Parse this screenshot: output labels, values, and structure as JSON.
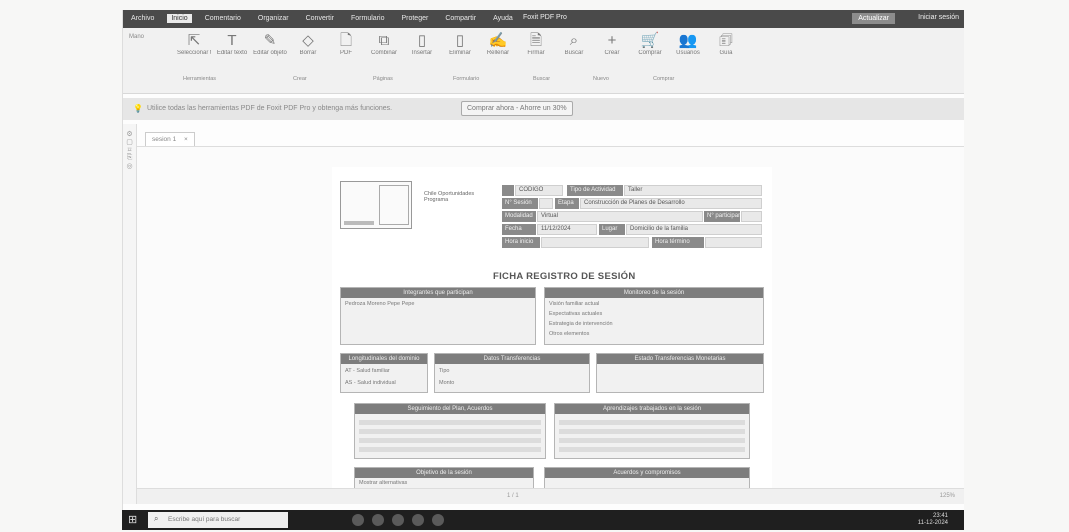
{
  "window": {
    "title": "Foxit PDF Pro",
    "upgrade_label": "Actualizar",
    "login_label": "Iniciar sesión",
    "tabs": [
      "Archivo",
      "Inicio",
      "Comentario",
      "Organizar",
      "Convertir",
      "Formulario",
      "Proteger",
      "Compartir",
      "Ayuda"
    ]
  },
  "ribbon": {
    "mano": "Mano",
    "groups": [
      {
        "icon": "text-select-icon",
        "glyph": "⇱",
        "label": "Seleccionar texto"
      },
      {
        "icon": "text-icon",
        "glyph": "T",
        "label": "Editar texto"
      },
      {
        "icon": "pencil-icon",
        "glyph": "✎",
        "label": "Editar objeto"
      },
      {
        "icon": "eraser-icon",
        "glyph": "◇",
        "label": "Borrar"
      },
      {
        "icon": "file-icon",
        "glyph": "🗋",
        "label": "PDF"
      },
      {
        "icon": "copy-icon",
        "glyph": "⧉",
        "label": "Combinar"
      },
      {
        "icon": "page-icon",
        "glyph": "▯",
        "label": "Insertar"
      },
      {
        "icon": "pages-icon",
        "glyph": "▯",
        "label": "Eliminar"
      },
      {
        "icon": "sign-icon",
        "glyph": "✍",
        "label": "Rellenar"
      },
      {
        "icon": "doc-icon",
        "glyph": "🗎",
        "label": "Firmar"
      },
      {
        "icon": "search-icon",
        "glyph": "⌕",
        "label": "Buscar"
      },
      {
        "icon": "plus-icon",
        "glyph": "+",
        "label": "Crear"
      },
      {
        "icon": "cart-icon",
        "glyph": "🛒",
        "label": "Comprar"
      },
      {
        "icon": "people-icon",
        "glyph": "👥",
        "label": "Usuarios"
      },
      {
        "icon": "info-icon",
        "glyph": "🗊",
        "label": "Guía"
      }
    ],
    "group_labels": [
      "Herramientas",
      "Crear",
      "Páginas",
      "Formulario",
      "Buscar",
      "Nuevo",
      "Comprar"
    ]
  },
  "notice": {
    "text": "Utilice todas las herramientas PDF de Foxit PDF Pro y obtenga más funciones.",
    "button": "Comprar ahora - Ahorre un 30%"
  },
  "document": {
    "tab_label": "sesion 1",
    "header": {
      "codigo_value": "CÓDIGO",
      "tipo_label": "Tipo de Actividad",
      "tipo_value": "Taller",
      "sesion_label": "N° Sesión",
      "etapa_label": "Etapa",
      "etapa_value": "Construcción de Planes de Desarrollo",
      "modalidad_label": "Modalidad",
      "modalidad_value": "Virtual",
      "participantes_label": "N° participantes",
      "fecha_label": "Fecha",
      "fecha_value": "11/12/2024",
      "lugar_label": "Lugar",
      "lugar_value": "Domicilio de la familia",
      "hora_inicio_label": "Hora inicio",
      "hora_termino_label": "Hora término"
    },
    "logo_text": "Chile Oportunidades Programa",
    "form_title": "FICHA REGISTRO DE SESIÓN",
    "integrantes_title": "Integrantes que participan",
    "integrantes_value": "Pedroza Moreno Pepe Pepe",
    "monitoreo_title": "Monitoreo de la sesión",
    "monitoreo_items": [
      "Visión familiar actual",
      "Expectativas actuales",
      "Estrategia de intervención",
      "Otros elementos"
    ],
    "longitudinales_title": "Longitudinales del dominio",
    "longitudinales_items": [
      "AT - Salud familiar",
      "AS - Salud individual"
    ],
    "datos_title": "Datos Transferencias",
    "datos_labels": [
      "Tipo",
      "Monto"
    ],
    "estado_title": "Estado Transferencias Monetarias",
    "tabla1_title": "Seguimiento del Plan, Acuerdos",
    "tabla2_title": "Aprendizajes trabajados en la sesión",
    "objetivo_title": "Objetivo de la sesión",
    "objetivo_value": "Mostrar alternativas",
    "acuerdos_title": "Acuerdos y compromisos"
  },
  "statusbar": {
    "page": "1 / 1",
    "zoom": "125%"
  },
  "taskbar": {
    "search_placeholder": "Escribe aquí para buscar",
    "time": "23:41",
    "date": "11-12-2024"
  }
}
